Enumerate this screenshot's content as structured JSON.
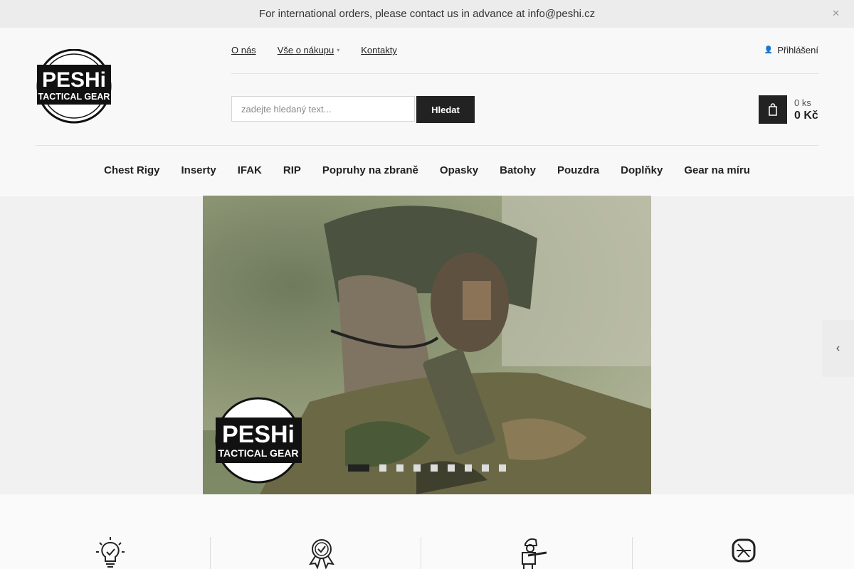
{
  "announcement": {
    "text": "For international orders, please contact us in advance at info@peshi.cz",
    "close_icon": "close-icon"
  },
  "logo": {
    "line1": "PESHi",
    "line2": "TACTICAL GEAR"
  },
  "top_links": [
    {
      "label": "O nás"
    },
    {
      "label": "Vše o nákupu",
      "has_dropdown": true
    },
    {
      "label": "Kontakty"
    }
  ],
  "login": {
    "label": "Přihlášení",
    "icon": "user-icon"
  },
  "search": {
    "placeholder": "zadejte hledaný text...",
    "button_label": "Hledat"
  },
  "cart": {
    "icon": "cart-icon",
    "quantity": "0 ks",
    "price": "0 Kč"
  },
  "nav": [
    "Chest Rigy",
    "Inserty",
    "IFAK",
    "RIP",
    "Popruhy na zbraně",
    "Opasky",
    "Batohy",
    "Pouzdra",
    "Doplňky",
    "Gear na míru"
  ],
  "banner": {
    "slide_count": 9,
    "active_slide": 1,
    "logo_line1": "PESHi",
    "logo_line2": "TACTICAL GEAR"
  },
  "features": [
    {
      "icon": "lightbulb-icon"
    },
    {
      "icon": "award-badge-icon"
    },
    {
      "icon": "soldier-icon"
    },
    {
      "icon": "shield-logo-icon"
    }
  ],
  "colors": {
    "dark": "#222222",
    "topbar": "#ececec",
    "header": "#f8f8f8"
  }
}
